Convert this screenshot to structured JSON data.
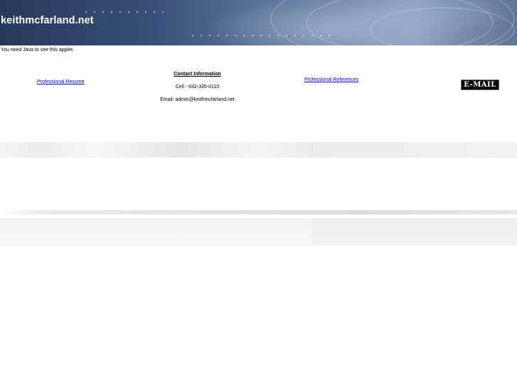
{
  "header": {
    "site_title": "keithmcfarland.net"
  },
  "applet": {
    "message": "You need Java to see this applet."
  },
  "links": {
    "resume": "Professional Resume",
    "references": "Professional References"
  },
  "contact": {
    "heading": "Contact Information",
    "cell": "Cell - 832-335-0110",
    "email": "Email: admin@keithmcfarland.net"
  },
  "email_button": {
    "label": "E-MAIL"
  }
}
